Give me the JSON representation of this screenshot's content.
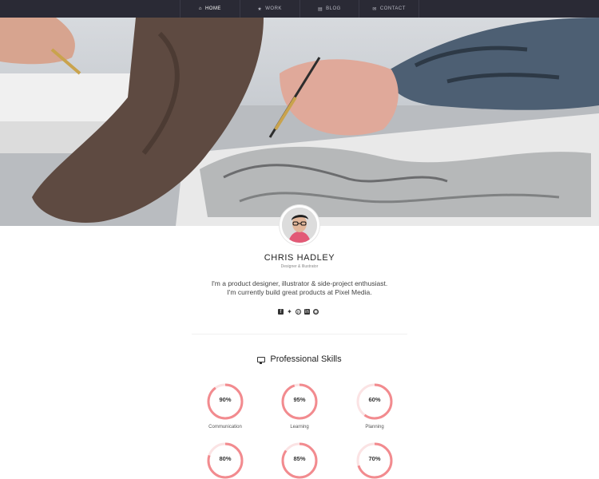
{
  "nav": {
    "items": [
      {
        "label": "Home",
        "icon": "home-icon",
        "active": true
      },
      {
        "label": "Work",
        "icon": "star-icon",
        "active": false
      },
      {
        "label": "Blog",
        "icon": "book-icon",
        "active": false
      },
      {
        "label": "Contact",
        "icon": "mail-icon",
        "active": false
      }
    ]
  },
  "profile": {
    "name": "CHRIS HADLEY",
    "role": "Designer & Illustrator",
    "bio_line1": "I'm a product designer, illustrator & side-project enthusiast.",
    "bio_line2": "I'm currently build great products at Pixel Media."
  },
  "social": [
    "facebook-icon",
    "twitter-icon",
    "pinterest-icon",
    "linkedin-icon",
    "github-icon"
  ],
  "skills": {
    "title": "Professional Skills",
    "items": [
      {
        "label": "Communication",
        "value": 90
      },
      {
        "label": "Learning",
        "value": 95
      },
      {
        "label": "Planning",
        "value": 60
      },
      {
        "label": "",
        "value": 80
      },
      {
        "label": "",
        "value": 85
      },
      {
        "label": "",
        "value": 70
      }
    ]
  },
  "colors": {
    "nav_bg": "#2a2a35",
    "skill_ring": "#f28b8f",
    "skill_track": "#fbe3e4"
  }
}
